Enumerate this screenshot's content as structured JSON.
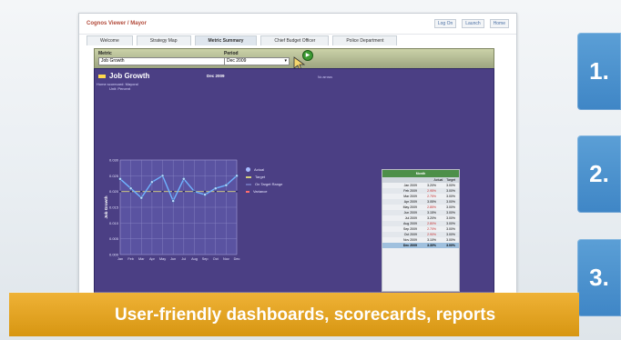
{
  "steps": [
    "1.",
    "2.",
    "3."
  ],
  "app": {
    "title": "Cognos Viewer / Mayor",
    "top_links": [
      "Log On",
      "Launch",
      "Home"
    ]
  },
  "tabs": [
    "Welcome",
    "Strategy Map",
    "Metric Summary",
    "Chief Budget Officer",
    "Police Department"
  ],
  "filters": {
    "metric_label": "Metric",
    "metric_value": "Job Growth",
    "period_label": "Period",
    "period_value": "Dec 2009"
  },
  "panel": {
    "title": "Job Growth",
    "scorecard": "Home scorecard: Mayoral",
    "unit": "Unit: Percent",
    "period": "Dec 2009",
    "no_arrows": "No arrows",
    "legend": [
      "Actual",
      "Target",
      "On Target Range",
      "Variance"
    ]
  },
  "chart_data": {
    "type": "line",
    "categories": [
      "Jan",
      "Feb",
      "Mar",
      "Apr",
      "May",
      "Jun",
      "Jul",
      "Aug",
      "Sep",
      "Oct",
      "Nov",
      "Dec"
    ],
    "series": [
      {
        "name": "Actual",
        "values": [
          0.024,
          0.021,
          0.018,
          0.023,
          0.025,
          0.017,
          0.024,
          0.02,
          0.019,
          0.021,
          0.022,
          0.025
        ]
      },
      {
        "name": "Target",
        "values": [
          0.02,
          0.02,
          0.02,
          0.02,
          0.02,
          0.02,
          0.02,
          0.02,
          0.02,
          0.02,
          0.02,
          0.02
        ]
      }
    ],
    "ylabel": "Job Growth",
    "ylim": [
      0,
      0.03
    ],
    "yticks": [
      0.0,
      0.005,
      0.01,
      0.015,
      0.02,
      0.025,
      0.03
    ]
  },
  "table": {
    "header": "Month",
    "columns": [
      "Actual",
      "Target"
    ],
    "rows": [
      {
        "label": "Jan 2009",
        "actual": "3.20%",
        "target": "3.00%"
      },
      {
        "label": "Feb 2009",
        "actual": "2.95%",
        "target": "3.00%"
      },
      {
        "label": "Mar 2009",
        "actual": "2.75%",
        "target": "3.00%"
      },
      {
        "label": "Apr 2009",
        "actual": "3.05%",
        "target": "3.00%"
      },
      {
        "label": "May 2009",
        "actual": "2.85%",
        "target": "3.00%"
      },
      {
        "label": "Jun 2009",
        "actual": "3.15%",
        "target": "3.00%"
      },
      {
        "label": "Jul 2009",
        "actual": "3.20%",
        "target": "3.00%"
      },
      {
        "label": "Aug 2009",
        "actual": "2.80%",
        "target": "3.00%"
      },
      {
        "label": "Sep 2009",
        "actual": "2.70%",
        "target": "3.00%"
      },
      {
        "label": "Oct 2009",
        "actual": "2.90%",
        "target": "3.00%"
      },
      {
        "label": "Nov 2009",
        "actual": "3.10%",
        "target": "3.00%"
      },
      {
        "label": "Dec 2009",
        "actual": "3.30%",
        "target": "3.00%"
      }
    ]
  },
  "banner": "User-friendly dashboards, scorecards, reports"
}
